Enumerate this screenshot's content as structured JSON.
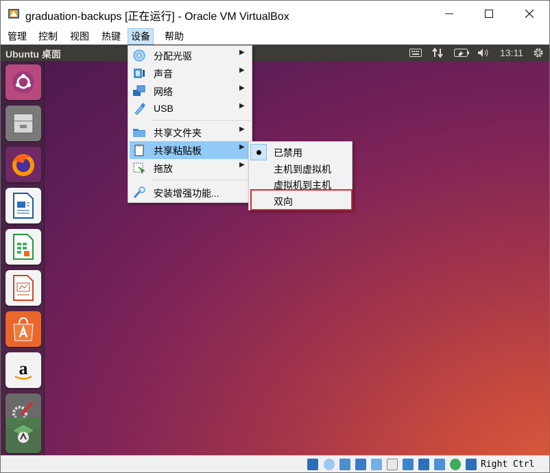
{
  "window": {
    "title": "graduation-backups [正在运行] - Oracle VM VirtualBox",
    "controls": [
      "minimize",
      "maximize",
      "close"
    ]
  },
  "menubar": {
    "items": [
      "管理",
      "控制",
      "视图",
      "热键",
      "设备",
      "帮助"
    ],
    "active": "设备"
  },
  "panel": {
    "title": "Ubuntu 桌面",
    "clock": "13:11",
    "icons": [
      "keyboard-icon",
      "network-arrows-icon",
      "battery-icon",
      "volume-icon",
      "settings-gear-icon"
    ]
  },
  "launcher": {
    "apps": [
      "ubuntu-icon",
      "file-manager-icon",
      "firefox-icon",
      "writer-icon",
      "calc-icon",
      "impress-icon",
      "software-center-icon",
      "amazon-icon",
      "system-settings-icon",
      "update-icon"
    ]
  },
  "devices_menu": {
    "items": [
      {
        "label": "分配光驱",
        "icon": "optical-disc-icon",
        "submenu": true
      },
      {
        "label": "声音",
        "icon": "audio-icon",
        "submenu": true
      },
      {
        "label": "网络",
        "icon": "network-icon",
        "submenu": true
      },
      {
        "label": "USB",
        "icon": "usb-icon",
        "submenu": true
      },
      {
        "label": "共享文件夹",
        "icon": "shared-folder-icon",
        "submenu": true
      },
      {
        "label": "共享粘贴板",
        "icon": "clipboard-icon",
        "submenu": true,
        "highlighted": true
      },
      {
        "label": "拖放",
        "icon": "drag-drop-icon",
        "submenu": true
      },
      {
        "label": "安装增强功能...",
        "icon": "guest-additions-icon",
        "submenu": false
      }
    ]
  },
  "clipboard_submenu": {
    "items": [
      {
        "label": "已禁用",
        "checked": true
      },
      {
        "label": "主机到虚拟机",
        "checked": false
      },
      {
        "label": "虚拟机到主机",
        "checked": false
      },
      {
        "label": "双向",
        "checked": false,
        "annotated": true
      }
    ]
  },
  "statusbar": {
    "host_key": "Right Ctrl"
  },
  "colors": {
    "menu_highlight": "#91c9f7",
    "annotation": "#e0262e",
    "panel": "#3c3b37"
  }
}
